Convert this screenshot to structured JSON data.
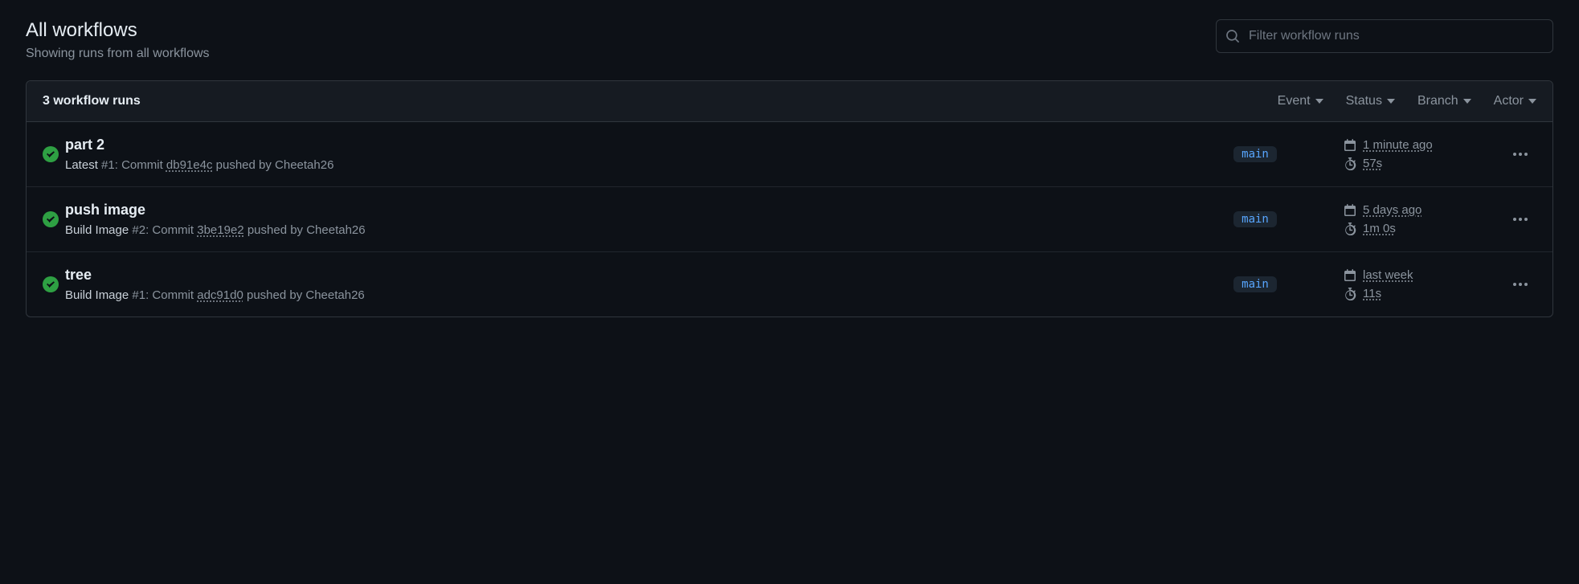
{
  "header": {
    "title": "All workflows",
    "subtitle": "Showing runs from all workflows"
  },
  "search": {
    "placeholder": "Filter workflow runs"
  },
  "list": {
    "count_label": "3 workflow runs",
    "filters": {
      "event": "Event",
      "status": "Status",
      "branch": "Branch",
      "actor": "Actor"
    }
  },
  "runs": [
    {
      "title": "part 2",
      "workflow_name": "Latest",
      "run_number": "#1",
      "commit_prefix": ": Commit ",
      "commit": "db91e4c",
      "pushed_by": " pushed by Cheetah26",
      "branch": "main",
      "time": "1 minute ago",
      "duration": "57s"
    },
    {
      "title": "push image",
      "workflow_name": "Build Image",
      "run_number": "#2",
      "commit_prefix": ": Commit ",
      "commit": "3be19e2",
      "pushed_by": " pushed by Cheetah26",
      "branch": "main",
      "time": "5 days ago",
      "duration": "1m 0s"
    },
    {
      "title": "tree",
      "workflow_name": "Build Image",
      "run_number": "#1",
      "commit_prefix": ": Commit ",
      "commit": "adc91d0",
      "pushed_by": " pushed by Cheetah26",
      "branch": "main",
      "time": "last week",
      "duration": "11s"
    }
  ]
}
